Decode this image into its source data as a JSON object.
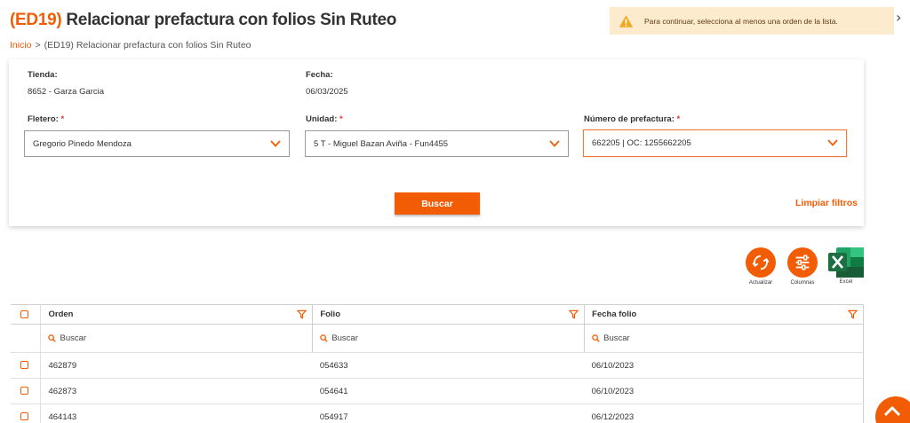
{
  "header": {
    "code": "(ED19)",
    "title": "Relacionar prefactura con folios Sin Ruteo",
    "breadcrumb": {
      "home": "Inicio",
      "separator": ">",
      "current": "(ED19) Relacionar prefactura con folios Sin Ruteo"
    }
  },
  "toast": {
    "message": "Para continuar, selecciona al menos una orden de la lista.",
    "close": "›"
  },
  "form": {
    "tienda_label": "Tienda:",
    "tienda_value": "8652 - Garza Garcia",
    "fecha_label": "Fecha:",
    "fecha_value": "06/03/2025",
    "fletero_label": "Fletero:",
    "fletero_value": "Gregorio Pinedo Mendoza",
    "unidad_label": "Unidad:",
    "unidad_value": "5 T - Miguel  Bazan Aviña - Fun4455",
    "prefactura_label": "Número de prefactura:",
    "prefactura_value": "662205 | OC: 1255662205",
    "required_mark": "*",
    "search_button": "Buscar",
    "clear_link": "Limpiar filtros"
  },
  "actions": {
    "refresh": "Actualizar",
    "columns": "Columnas",
    "excel": "Excel"
  },
  "table": {
    "columns": [
      "Orden",
      "Folio",
      "Fecha folio"
    ],
    "search_placeholder": "Buscar",
    "rows": [
      [
        "462879",
        "054633",
        "06/10/2023"
      ],
      [
        "462873",
        "054641",
        "06/10/2023"
      ],
      [
        "464143",
        "054917",
        "06/12/2023"
      ]
    ]
  },
  "colors": {
    "accent": "#f25c05",
    "toast_bg": "#fdebcd",
    "required": "#e53935",
    "excel": "#1d6f42"
  }
}
